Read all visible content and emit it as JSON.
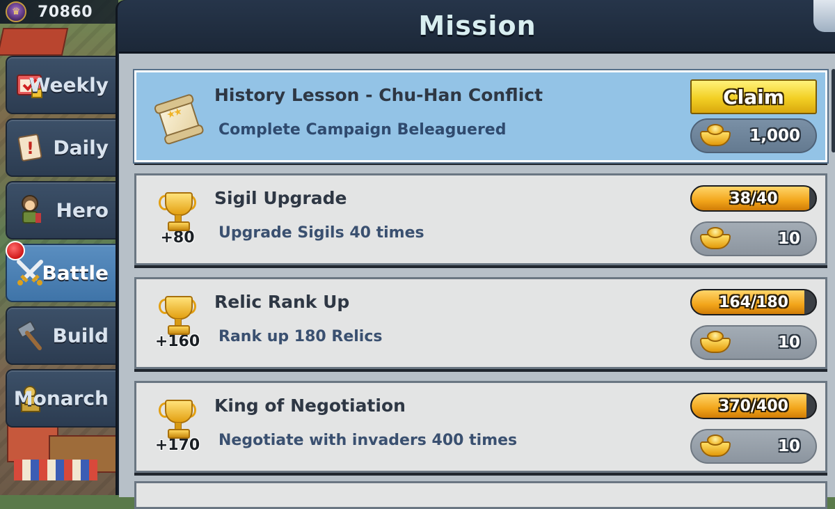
{
  "resource": {
    "icon": "crown-shield-icon",
    "value": "70860"
  },
  "sidebar": {
    "tabs": [
      {
        "label": "Weekly",
        "icon": "weekly-calendar-icon",
        "active": false,
        "notification": false
      },
      {
        "label": "Daily",
        "icon": "daily-note-icon",
        "active": false,
        "notification": false
      },
      {
        "label": "Hero",
        "icon": "hero-soldier-icon",
        "active": false,
        "notification": false
      },
      {
        "label": "Battle",
        "icon": "crossed-swords-icon",
        "active": true,
        "notification": true
      },
      {
        "label": "Build",
        "icon": "hammer-icon",
        "active": false,
        "notification": false
      },
      {
        "label": "Monarch",
        "icon": "monarch-statue-icon",
        "active": false,
        "notification": false
      }
    ]
  },
  "panel": {
    "title": "Mission"
  },
  "missions": [
    {
      "title": "History Lesson - Chu-Han Conflict",
      "description": "Complete Campaign Beleaguered",
      "icon": "scroll-icon",
      "claim_label": "Claim",
      "reward": "1,000",
      "reward_icon": "gold-ingot-icon",
      "highlight": true
    },
    {
      "title": "Sigil Upgrade",
      "description": "Upgrade Sigils 40 times",
      "icon": "trophy-icon",
      "points": "+80",
      "progress_text": "38/40",
      "progress_fraction": 0.95,
      "reward": "10",
      "reward_icon": "gold-ingot-icon"
    },
    {
      "title": "Relic Rank Up",
      "description": "Rank up 180 Relics",
      "icon": "trophy-icon",
      "points": "+160",
      "progress_text": "164/180",
      "progress_fraction": 0.911,
      "reward": "10",
      "reward_icon": "gold-ingot-icon"
    },
    {
      "title": "King of Negotiation",
      "description": "Negotiate with invaders 400 times",
      "icon": "trophy-icon",
      "points": "+170",
      "progress_text": "370/400",
      "progress_fraction": 0.925,
      "reward": "10",
      "reward_icon": "gold-ingot-icon"
    }
  ],
  "colors": {
    "highlight_card": "#93c3e6",
    "card": "#e3e4e4",
    "claim_button": "#f2cf24",
    "progress_fill": "#f2a51a",
    "active_tab": "#4a80b4",
    "notification": "#d01818"
  }
}
